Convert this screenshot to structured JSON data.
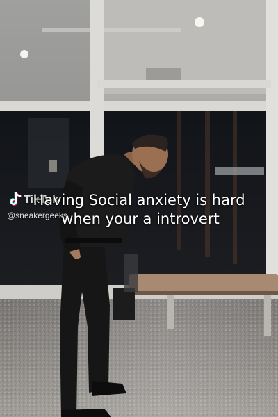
{
  "caption": {
    "line1": "Having Social anxiety is hard",
    "line2": "when your a introvert"
  },
  "watermark": {
    "logo_icon": "tiktok-logo-icon",
    "brand": "TikTok",
    "handle": "@sneakergeeks"
  },
  "colors": {
    "caption_text": "#ffffff",
    "logo_cyan": "#25f4ee",
    "logo_pink": "#fe2c55"
  }
}
